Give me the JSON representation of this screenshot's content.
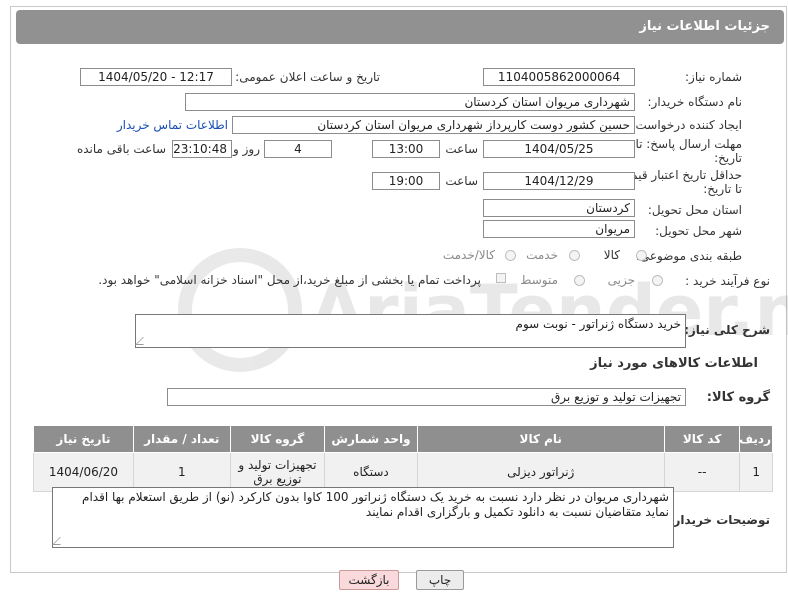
{
  "header": {
    "title": "جزئیات اطلاعات نیاز"
  },
  "form": {
    "need_number_label": "شماره نیاز:",
    "need_number": "1104005862000064",
    "announce_label": "تاریخ و ساعت اعلان عمومی:",
    "announce_value": "1404/05/20 - 12:17",
    "buyer_org_label": "نام دستگاه خریدار:",
    "buyer_org": "شهرداری مریوان استان کردستان",
    "creator_label": "ایجاد کننده درخواست:",
    "creator": "حسین کشور دوست کارپرداز شهرداری مریوان استان کردستان",
    "contact_link": "اطلاعات تماس خریدار",
    "deadline_label_1": "مهلت ارسال پاسخ: تا",
    "deadline_label_2": "تاریخ:",
    "deadline_date": "1404/05/25",
    "hour_label": "ساعت",
    "deadline_time": "13:00",
    "days_value": "4",
    "days_label": "روز و",
    "remaining_value": "23:10:48",
    "remaining_label": "ساعت باقی مانده",
    "validity_label_1": "حداقل تاریخ اعتبار قیمت:",
    "validity_label_2": "تا تاریخ:",
    "validity_date": "1404/12/29",
    "validity_time": "19:00",
    "province_label": "استان محل تحویل:",
    "province": "کردستان",
    "city_label": "شهر محل تحویل:",
    "city": "مریوان",
    "category_label": "طبقه بندی موضوعی:",
    "category_options": [
      "کالا",
      "خدمت",
      "کالا/خدمت"
    ],
    "process_label": "نوع فرآیند خرید :",
    "process_options": [
      "جزیی",
      "متوسط"
    ],
    "payment_note": "پرداخت تمام یا بخشی از مبلغ خرید،از محل \"اسناد خزانه اسلامی\" خواهد بود."
  },
  "description": {
    "label": "شرح کلی نیاز:",
    "text": "خرید دستگاه ژنراتور - نوبت سوم"
  },
  "goods": {
    "section_title": "اطلاعات کالاهای مورد نیاز",
    "group_label": "گروه کالا:",
    "group_value": "تجهیزات تولید و توزیع برق",
    "columns": [
      "ردیف",
      "کد کالا",
      "نام کالا",
      "واحد شمارش",
      "گروه کالا",
      "تعداد / مقدار",
      "تاریخ نیاز"
    ],
    "rows": [
      {
        "row": "1",
        "code": "--",
        "name": "ژنراتور دیزلی",
        "unit": "دستگاه",
        "group": "تجهیزات تولید و توزیع برق",
        "qty": "1",
        "date": "1404/06/20"
      }
    ]
  },
  "buyer_notes": {
    "label": "توضیحات خریدار:",
    "text": "شهرداری مریوان در نظر دارد نسبت به خرید یک دستگاه ژنراتور 100 کاوا بدون کارکرد (نو) از طریق استعلام بها اقدام نماید متقاضیان نسبت به دانلود تکمیل و بارگزاری اقدام نمایند"
  },
  "buttons": {
    "print": "چاپ",
    "back": "بازگشت"
  }
}
